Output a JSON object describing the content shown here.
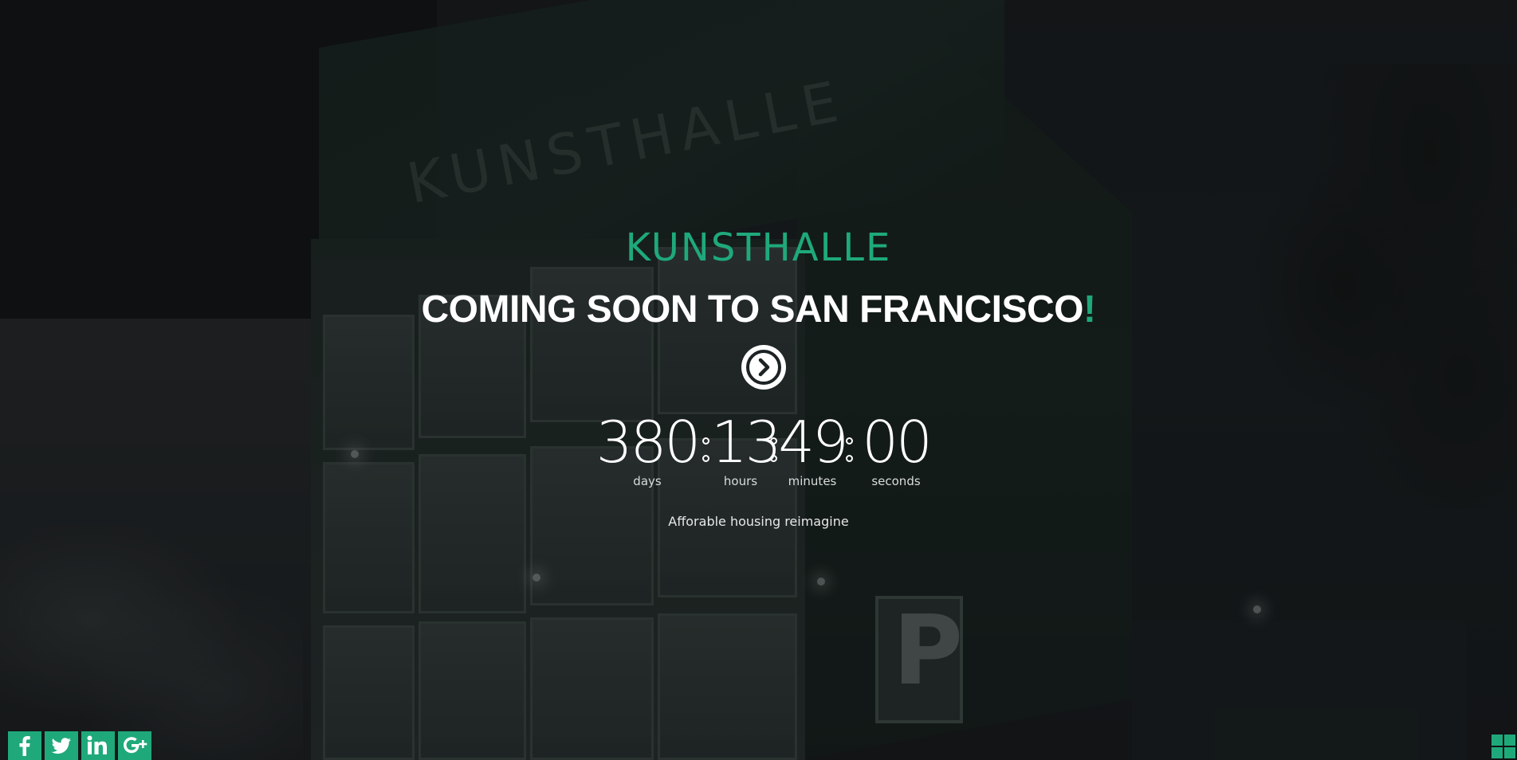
{
  "brand": {
    "logo_text": "KUNSTHALLE"
  },
  "hero": {
    "headline": "COMING SOON TO SAN FRANCISCO",
    "headline_accent": "!",
    "next_button_icon": "chevron-right-circle-icon",
    "tagline": "Afforable housing reimagine"
  },
  "countdown": {
    "days": "380",
    "hours": "13",
    "minutes": "49",
    "seconds": "00",
    "labels": {
      "days": "days",
      "hours": "hours",
      "minutes": "minutes",
      "seconds": "seconds"
    }
  },
  "social": [
    {
      "name": "facebook",
      "icon": "facebook-icon"
    },
    {
      "name": "twitter",
      "icon": "twitter-icon"
    },
    {
      "name": "linkedin",
      "icon": "linkedin-icon"
    },
    {
      "name": "google-plus",
      "icon": "google-plus-icon"
    }
  ],
  "theme": {
    "accent": "#1fa97a",
    "text": "#ffffff"
  }
}
